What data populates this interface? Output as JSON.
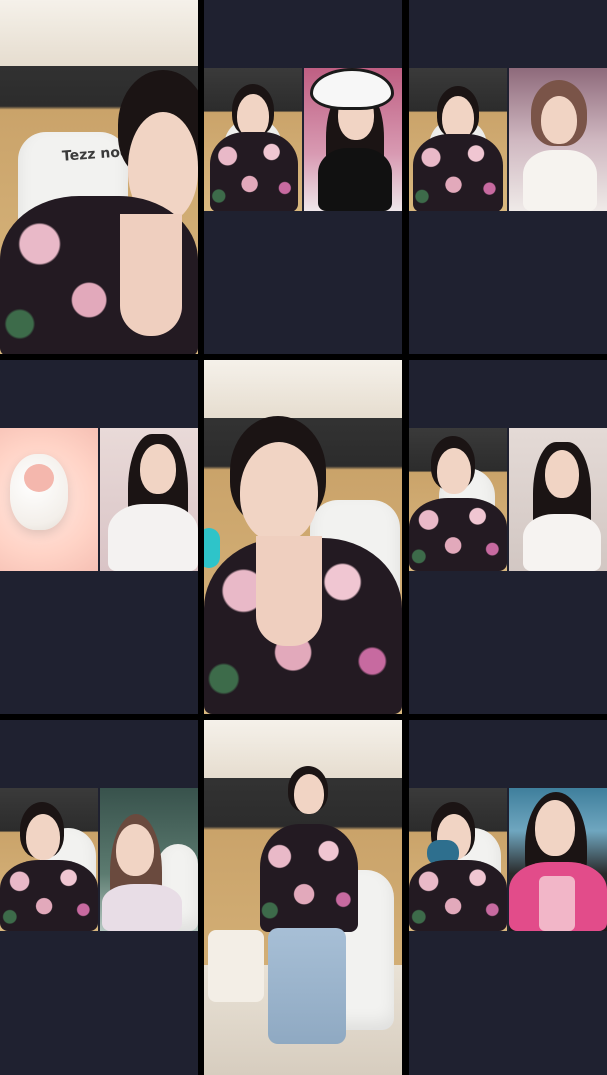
{
  "screen": {
    "background": "#000000",
    "tile_background": "#1f2130",
    "accent_cyan": "#2ec4c9"
  },
  "grid": {
    "tiles": [
      {
        "id": "r1c1",
        "type": "single-feed",
        "chair_text": "Tezz noqa"
      },
      {
        "id": "r1c2",
        "type": "pk-duo"
      },
      {
        "id": "r1c3",
        "type": "pk-duo"
      },
      {
        "id": "r2c1",
        "type": "pk-duo",
        "left_avatar": "sheep-avatar"
      },
      {
        "id": "r2c2",
        "type": "single-feed"
      },
      {
        "id": "r2c3",
        "type": "pk-duo"
      },
      {
        "id": "r3c1",
        "type": "pk-duo"
      },
      {
        "id": "r3c2",
        "type": "single-feed"
      },
      {
        "id": "r3c3",
        "type": "pk-duo"
      }
    ]
  }
}
